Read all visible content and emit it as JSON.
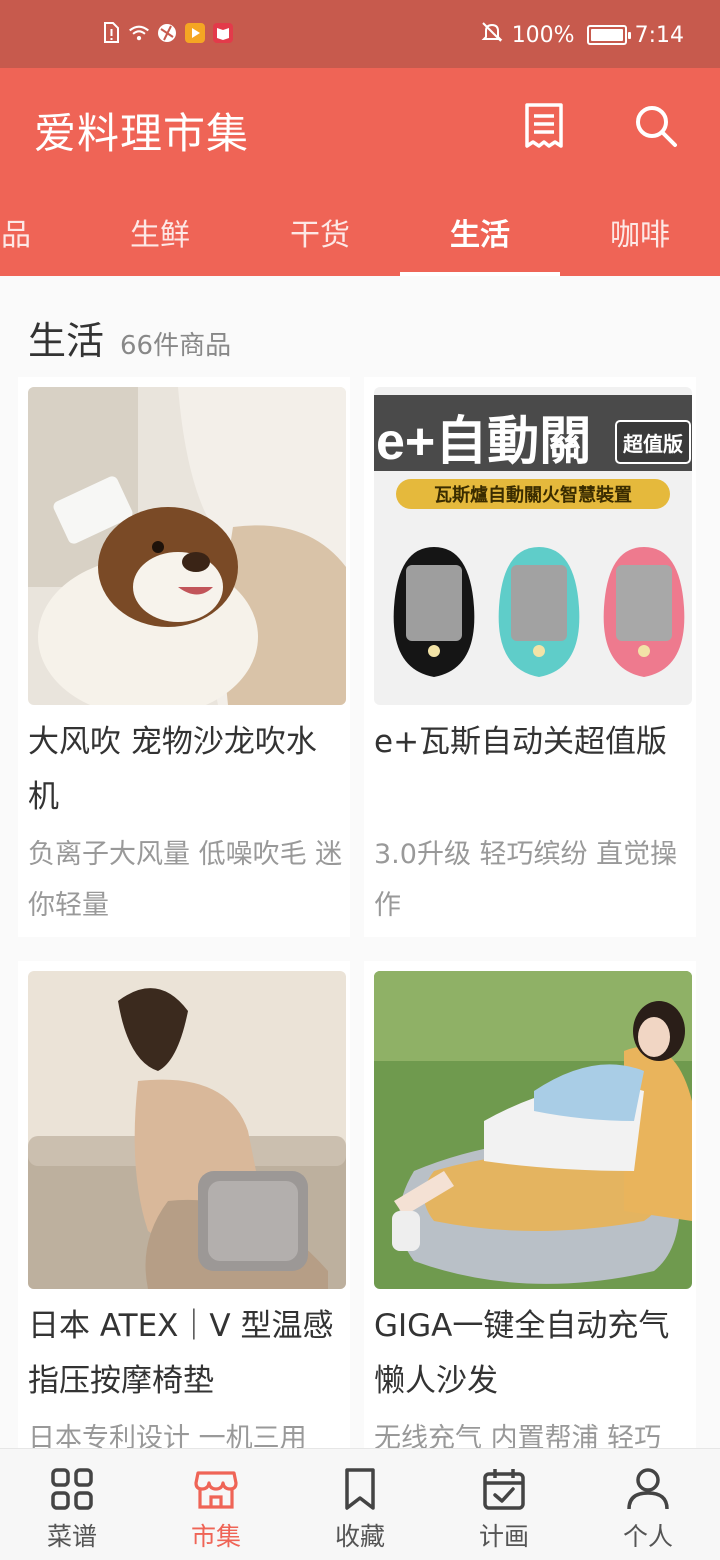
{
  "status_bar": {
    "battery": "100%",
    "time": "7:14",
    "battery_level": 1.0
  },
  "header": {
    "title": "爱料理市集",
    "tabs": [
      {
        "label": "品"
      },
      {
        "label": "生鲜"
      },
      {
        "label": "干货"
      },
      {
        "label": "生活"
      },
      {
        "label": "咖啡"
      }
    ],
    "active_tab": "生活"
  },
  "section": {
    "title": "生活",
    "count": "66件商品"
  },
  "products": [
    {
      "name": "大风吹 宠物沙龙吹水机",
      "desc": "负离子大风量 低噪吹毛 迷你轻量",
      "image": "dog-dryer-photo"
    },
    {
      "name": "e+瓦斯自动关超值版",
      "desc": "3.0升级 轻巧缤纷 直觉操作",
      "image": "gas-shutoff-photo",
      "image_text": {
        "brand": "e+自動關",
        "badge": "超值版",
        "subtitle": "瓦斯爐自動關火智慧裝置"
      }
    },
    {
      "name": "日本 ATEX｜V 型温感指压按摩椅垫",
      "desc": "日本专利设计 一机三用",
      "image": "massage-cushion-photo"
    },
    {
      "name": " GIGA一键全自动充气懒人沙发",
      "desc": "无线充气 内置帮浦 轻巧",
      "image": "inflatable-sofa-photo"
    }
  ],
  "bottom_nav": [
    {
      "label": "菜谱",
      "icon": "grid-icon"
    },
    {
      "label": "市集",
      "icon": "store-icon"
    },
    {
      "label": "收藏",
      "icon": "bookmark-icon"
    },
    {
      "label": "计画",
      "icon": "calendar-check-icon"
    },
    {
      "label": "个人",
      "icon": "person-icon"
    }
  ],
  "colors": {
    "accent": "#ef6456",
    "status_bar": "#c75a4d"
  }
}
